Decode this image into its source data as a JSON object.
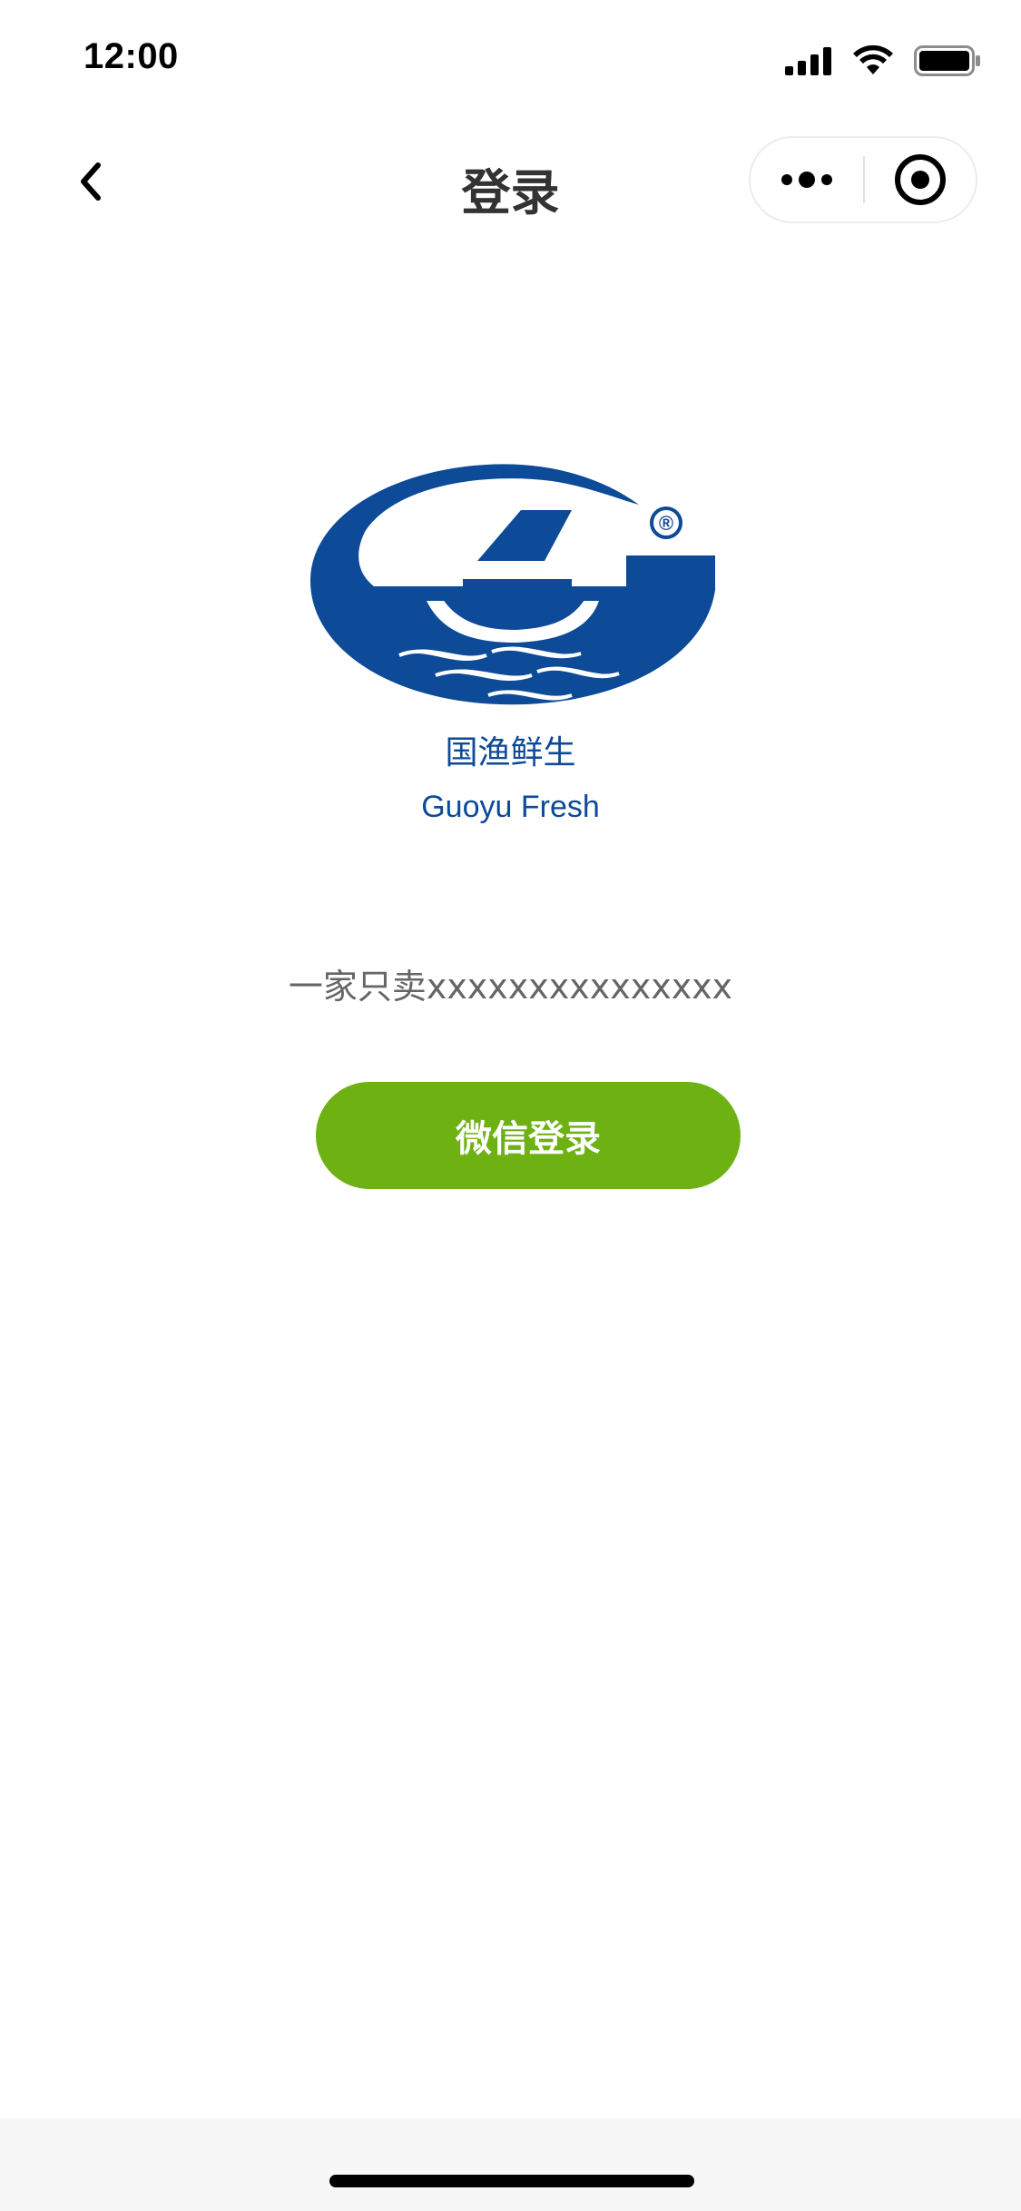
{
  "status_bar": {
    "time": "12:00",
    "signal_icon": "signal-icon",
    "wifi_icon": "wifi-icon",
    "battery_icon": "battery-icon"
  },
  "nav": {
    "back_icon": "chevron-left-icon",
    "title": "登录",
    "more_icon": "more-dots-icon",
    "close_icon": "target-circle-icon"
  },
  "brand": {
    "name_cn": "国渔鲜生",
    "name_en": "Guoyu Fresh",
    "logo_registered_mark": "®",
    "color": "#0d4a97"
  },
  "main": {
    "slogan": "一家只卖xxxxxxxxxxxxxxx",
    "login_button_label": "微信登录",
    "login_button_color": "#6db112"
  }
}
